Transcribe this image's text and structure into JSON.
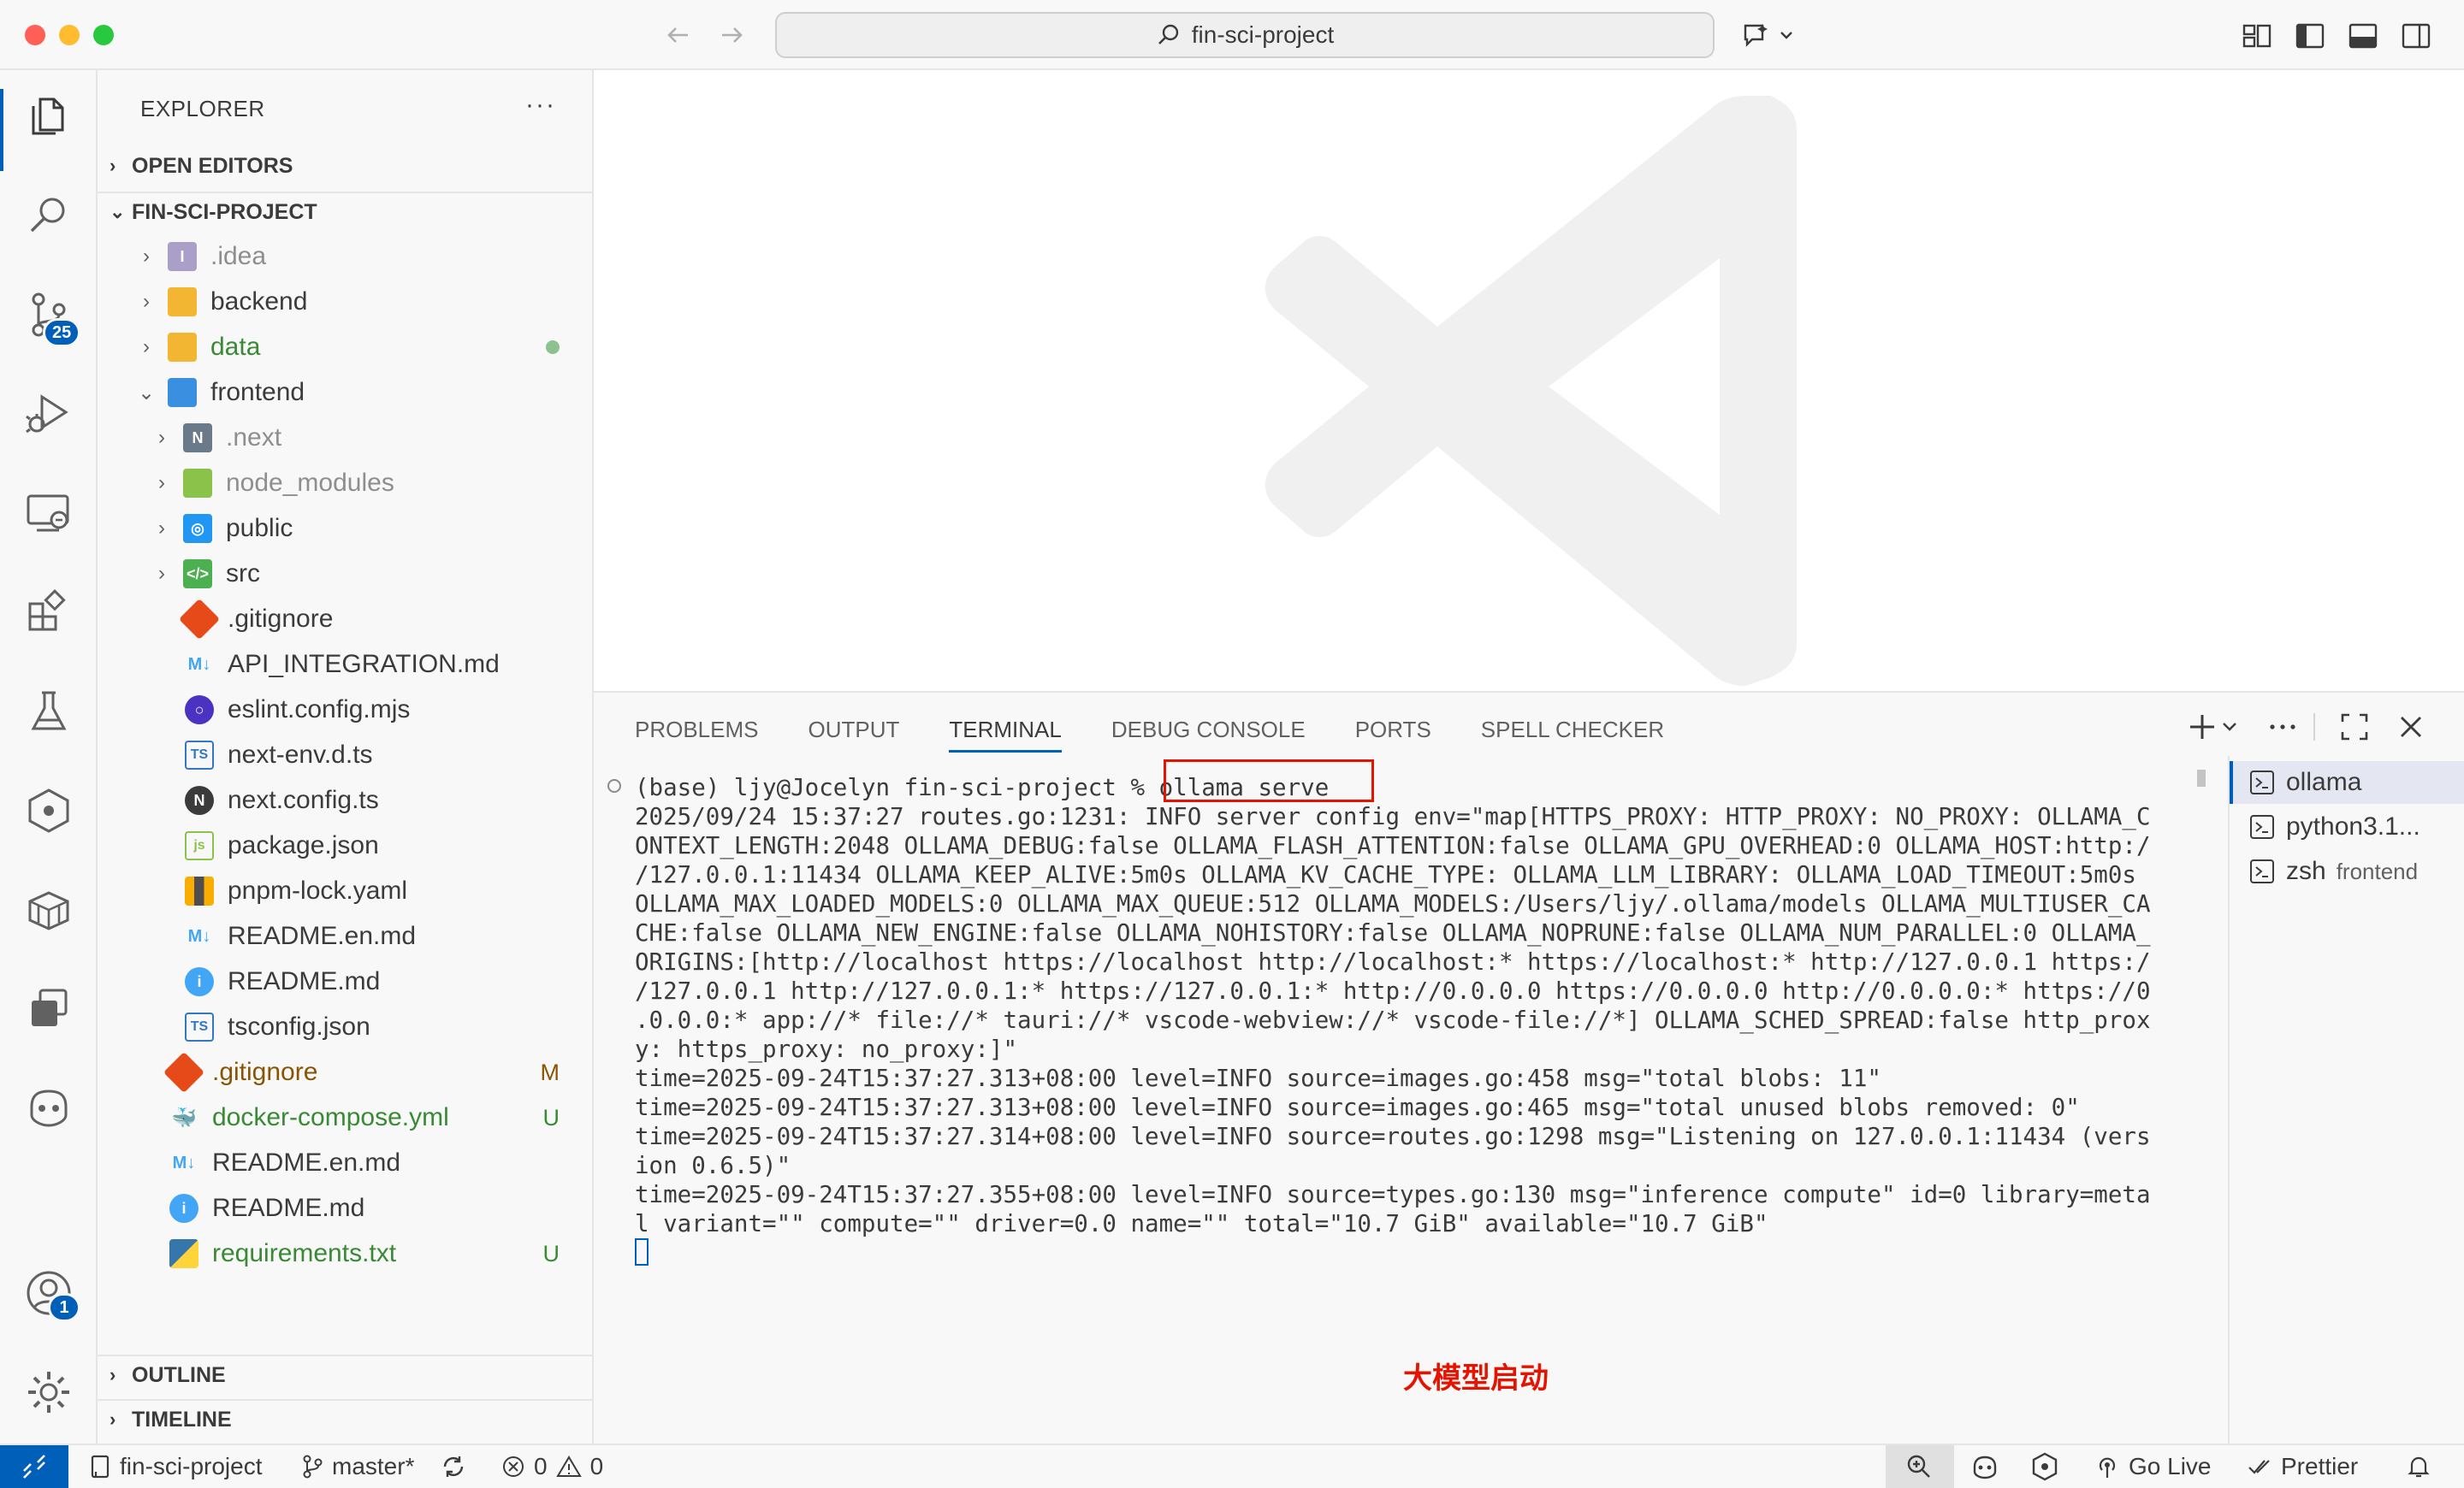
{
  "titlebar": {
    "search_text": "fin-sci-project"
  },
  "activity": {
    "scm_badge": "25",
    "accounts_badge": "1"
  },
  "explorer": {
    "title": "EXPLORER",
    "more": "···",
    "open_editors": "OPEN EDITORS",
    "project": "FIN-SCI-PROJECT",
    "outline": "OUTLINE",
    "timeline": "TIMELINE",
    "items": [
      {
        "label": ".idea",
        "status": ""
      },
      {
        "label": "backend",
        "status": ""
      },
      {
        "label": "data",
        "status": ""
      },
      {
        "label": "frontend",
        "status": ""
      },
      {
        "label": ".next",
        "status": ""
      },
      {
        "label": "node_modules",
        "status": ""
      },
      {
        "label": "public",
        "status": ""
      },
      {
        "label": "src",
        "status": ""
      },
      {
        "label": ".gitignore",
        "status": ""
      },
      {
        "label": "API_INTEGRATION.md",
        "status": ""
      },
      {
        "label": "eslint.config.mjs",
        "status": ""
      },
      {
        "label": "next-env.d.ts",
        "status": ""
      },
      {
        "label": "next.config.ts",
        "status": ""
      },
      {
        "label": "package.json",
        "status": ""
      },
      {
        "label": "pnpm-lock.yaml",
        "status": ""
      },
      {
        "label": "README.en.md",
        "status": ""
      },
      {
        "label": "README.md",
        "status": ""
      },
      {
        "label": "tsconfig.json",
        "status": ""
      },
      {
        "label": ".gitignore",
        "status": "M"
      },
      {
        "label": "docker-compose.yml",
        "status": "U"
      },
      {
        "label": "README.en.md",
        "status": ""
      },
      {
        "label": "README.md",
        "status": ""
      },
      {
        "label": "requirements.txt",
        "status": "U"
      }
    ]
  },
  "panel": {
    "tabs": [
      "PROBLEMS",
      "OUTPUT",
      "TERMINAL",
      "DEBUG CONSOLE",
      "PORTS",
      "SPELL CHECKER"
    ],
    "terminal_lines": [
      "(base) ljy@Jocelyn fin-sci-project % ollama serve",
      "2025/09/24 15:37:27 routes.go:1231: INFO server config env=\"map[HTTPS_PROXY: HTTP_PROXY: NO_PROXY: OLLAMA_C",
      "ONTEXT_LENGTH:2048 OLLAMA_DEBUG:false OLLAMA_FLASH_ATTENTION:false OLLAMA_GPU_OVERHEAD:0 OLLAMA_HOST:http:/",
      "/127.0.0.1:11434 OLLAMA_KEEP_ALIVE:5m0s OLLAMA_KV_CACHE_TYPE: OLLAMA_LLM_LIBRARY: OLLAMA_LOAD_TIMEOUT:5m0s",
      "OLLAMA_MAX_LOADED_MODELS:0 OLLAMA_MAX_QUEUE:512 OLLAMA_MODELS:/Users/ljy/.ollama/models OLLAMA_MULTIUSER_CA",
      "CHE:false OLLAMA_NEW_ENGINE:false OLLAMA_NOHISTORY:false OLLAMA_NOPRUNE:false OLLAMA_NUM_PARALLEL:0 OLLAMA_",
      "ORIGINS:[http://localhost https://localhost http://localhost:* https://localhost:* http://127.0.0.1 https:/",
      "/127.0.0.1 http://127.0.0.1:* https://127.0.0.1:* http://0.0.0.0 https://0.0.0.0 http://0.0.0.0:* https://0",
      ".0.0.0:* app://* file://* tauri://* vscode-webview://* vscode-file://*] OLLAMA_SCHED_SPREAD:false http_prox",
      "y: https_proxy: no_proxy:]\"",
      "time=2025-09-24T15:37:27.313+08:00 level=INFO source=images.go:458 msg=\"total blobs: 11\"",
      "time=2025-09-24T15:37:27.313+08:00 level=INFO source=images.go:465 msg=\"total unused blobs removed: 0\"",
      "time=2025-09-24T15:37:27.314+08:00 level=INFO source=routes.go:1298 msg=\"Listening on 127.0.0.1:11434 (vers",
      "ion 0.6.5)\"",
      "time=2025-09-24T15:37:27.355+08:00 level=INFO source=types.go:130 msg=\"inference compute\" id=0 library=meta",
      "l variant=\"\" compute=\"\" driver=0.0 name=\"\" total=\"10.7 GiB\" available=\"10.7 GiB\""
    ],
    "annotation": "大模型启动",
    "terminals": [
      {
        "name": "ollama",
        "sub": ""
      },
      {
        "name": "python3.1...",
        "sub": ""
      },
      {
        "name": "zsh",
        "sub": "frontend"
      }
    ]
  },
  "statusbar": {
    "project": "fin-sci-project",
    "branch": "master*",
    "errors": "0",
    "warnings": "0",
    "golive": "Go Live",
    "prettier": "Prettier"
  }
}
